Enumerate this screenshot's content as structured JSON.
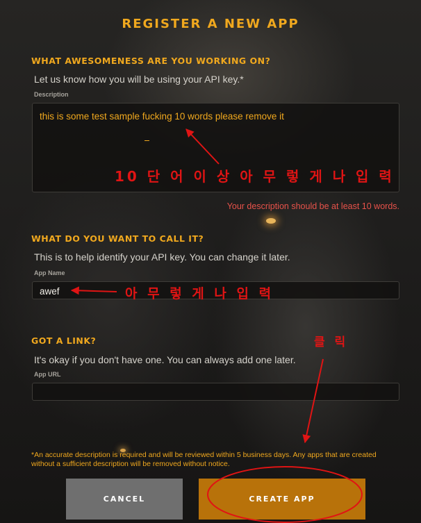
{
  "page": {
    "title": "REGISTER A NEW APP"
  },
  "sections": {
    "description": {
      "heading": "WHAT AWESOMENESS ARE YOU WORKING ON?",
      "hint": "Let us know how you will be using your API key.*",
      "label": "Description",
      "value": "this is some test sample fucking 10 words please remove it",
      "error": "Your description should be at least 10 words."
    },
    "app_name": {
      "heading": "WHAT DO YOU WANT TO CALL IT?",
      "hint": "This is to help identify your API key. You can change it later.",
      "label": "App Name",
      "value": "awef"
    },
    "app_url": {
      "heading": "GOT A LINK?",
      "hint": "It's okay if you don't have one. You can always add one later.",
      "label": "App URL",
      "value": ""
    }
  },
  "footnote": "*An accurate description is required and will be reviewed within 5 business days. Any apps that are created without a sufficient description will be removed without notice.",
  "buttons": {
    "cancel": "CANCEL",
    "create": "CREATE APP"
  },
  "annotations": {
    "description_note": "10 단 어  이 상  아 무 렇 게 나  입 력",
    "name_note": "아 무 렇 게 나  입 력",
    "click_note": "클 릭"
  },
  "colors": {
    "accent": "#f0a81e",
    "error": "#e8524a",
    "annotation": "#e01414",
    "create_button": "#b8720a",
    "cancel_button": "#6f6f6f"
  }
}
